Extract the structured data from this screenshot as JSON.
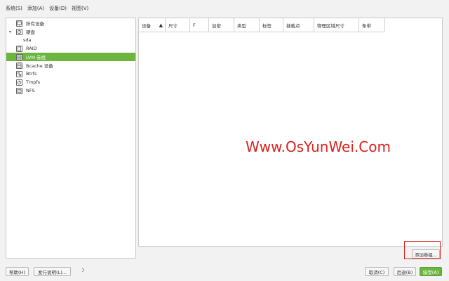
{
  "menu": [
    "系统(S)",
    "添加(A)",
    "设备(D)",
    "视图(V)"
  ],
  "tree": {
    "all_devices": "所有设备",
    "disks": "硬盘",
    "sda": "sda",
    "raid": "RAID",
    "lvm": "LVM 卷组",
    "bcache": "Bcache 设备",
    "btrfs": "Btrfs",
    "tmpfs": "Tmpfs",
    "nfs": "NFS"
  },
  "table": {
    "columns": [
      "设备",
      "尺寸",
      "F",
      "加密",
      "类型",
      "标签",
      "挂载点",
      "物理区域尺寸",
      "条带"
    ]
  },
  "watermark": "Www.OsYunWei.Com",
  "buttons": {
    "add_vg": "添加卷组...",
    "help": "帮助(H)",
    "release_notes": "发行说明(L)...",
    "cancel": "取消(C)",
    "back": "后退(B)",
    "accept": "接受(A)"
  },
  "colors": {
    "accent": "#6cb53f",
    "highlight_box": "#d6201c",
    "watermark": "#d9231f"
  }
}
